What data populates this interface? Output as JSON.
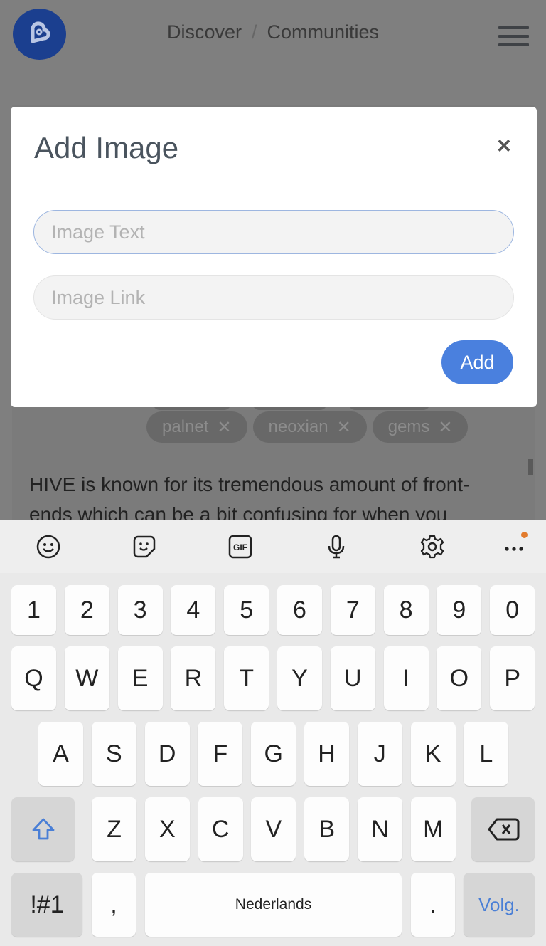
{
  "header": {
    "breadcrumb": [
      "Discover",
      "Communities"
    ],
    "separator": "/"
  },
  "page": {
    "tags": [
      {
        "label": "palnet"
      },
      {
        "label": "neoxian"
      },
      {
        "label": "gems"
      }
    ],
    "tag_remove": "✕",
    "body_lines": [
      "HIVE is known for its tremendous amount of front-",
      "ends which can be a bit confusing for when you"
    ]
  },
  "modal": {
    "title": "Add Image",
    "close": "×",
    "image_text_placeholder": "Image Text",
    "image_link_placeholder": "Image Link",
    "image_text_value": "",
    "image_link_value": "",
    "add_label": "Add"
  },
  "keyboard": {
    "toolbar": [
      "emoji-icon",
      "sticker-icon",
      "gif-icon",
      "microphone-icon",
      "settings-icon",
      "more-icon"
    ],
    "rows": [
      [
        "1",
        "2",
        "3",
        "4",
        "5",
        "6",
        "7",
        "8",
        "9",
        "0"
      ],
      [
        "Q",
        "W",
        "E",
        "R",
        "T",
        "Y",
        "U",
        "I",
        "O",
        "P"
      ],
      [
        "A",
        "S",
        "D",
        "F",
        "G",
        "H",
        "J",
        "K",
        "L"
      ],
      [
        "Z",
        "X",
        "C",
        "V",
        "B",
        "N",
        "M"
      ]
    ],
    "symbols_label": "!#1",
    "comma": ",",
    "space_label": "Nederlands",
    "period": ".",
    "enter_label": "Volg.",
    "accent": "#4a7fd6",
    "notification_color": "#e27b2d"
  }
}
